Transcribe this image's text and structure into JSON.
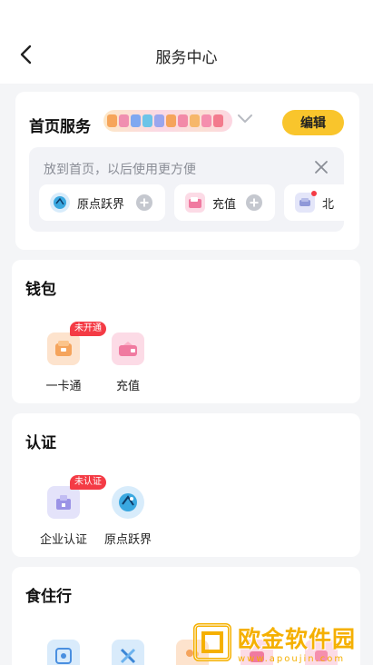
{
  "header": {
    "title": "服务中心"
  },
  "home_services": {
    "title": "首页服务",
    "edit_label": "编辑",
    "pin_hint": "放到首页，以后使用更方便",
    "pinned": [
      {
        "label": "原点跃界",
        "icon": "globe-icon"
      },
      {
        "label": "充值",
        "icon": "card-icon"
      },
      {
        "label": "北",
        "icon": "car-icon"
      }
    ]
  },
  "wallet": {
    "title": "钱包",
    "items": [
      {
        "label": "一卡通",
        "badge": "未开通",
        "icon": "card-pass-icon"
      },
      {
        "label": "充值",
        "icon": "recharge-icon"
      }
    ]
  },
  "certification": {
    "title": "认证",
    "items": [
      {
        "label": "企业认证",
        "badge": "未认证",
        "icon": "enterprise-icon"
      },
      {
        "label": "原点跃界",
        "icon": "globe-icon"
      }
    ]
  },
  "food_travel": {
    "title": "食住行"
  },
  "watermark": {
    "text": "欧金软件园",
    "url": "www.apoujin.com"
  },
  "colors": {
    "accent": "#f9c52c",
    "badge": "#f43b45",
    "background": "#f4f5f7"
  }
}
